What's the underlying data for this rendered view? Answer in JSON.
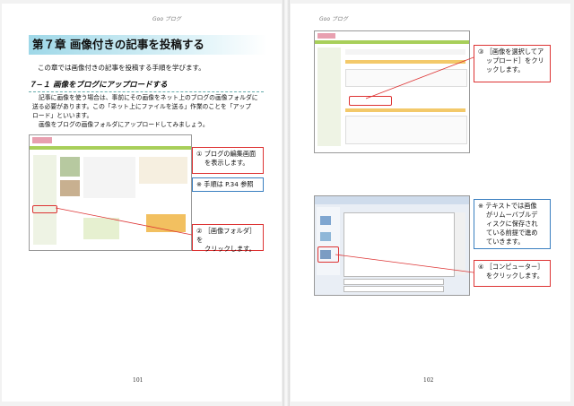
{
  "header": {
    "left": "Goo ブログ",
    "right": "Goo ブログ"
  },
  "left": {
    "chapter_title": "第７章  画像付きの記事を投稿する",
    "intro": "この章では画像付きの記事を投稿する手順を学びます。",
    "section_title": "７−１  画像をブログにアップロードする",
    "paragraph": [
      "記事に画像を使う場合は、事前にその画像をネット上のブログの画像フォルダに",
      "送る必要があります。この「ネット上にファイルを送る」作業のことを「アップ",
      "ロード」といいます。",
      "画像をブログの画像フォルダにアップロードしてみましょう。"
    ],
    "callouts": {
      "c1": [
        "①  ブログの編集画面",
        "を表示します。"
      ],
      "note": "※  手順は P.34 参照",
      "c2": [
        "②  ［画像フォルダ］を",
        "クリックします。"
      ]
    },
    "page_number": "101"
  },
  "right": {
    "callouts": {
      "c3": [
        "③  ［画像を選択してア",
        "ップロード］をクリ",
        "ックします。"
      ],
      "note": [
        "※  テキストでは画像",
        "がリムーバブルデ",
        "ィスクに保存され",
        "ている前提で進め",
        "ていきます。"
      ],
      "c4": [
        "④  ［コンピューター］",
        "をクリックします。"
      ]
    },
    "page_number": "102"
  },
  "colors": {
    "accent": "#d33333",
    "note_border": "#3a7fc0",
    "chapter_band": "#9fd8e8"
  }
}
